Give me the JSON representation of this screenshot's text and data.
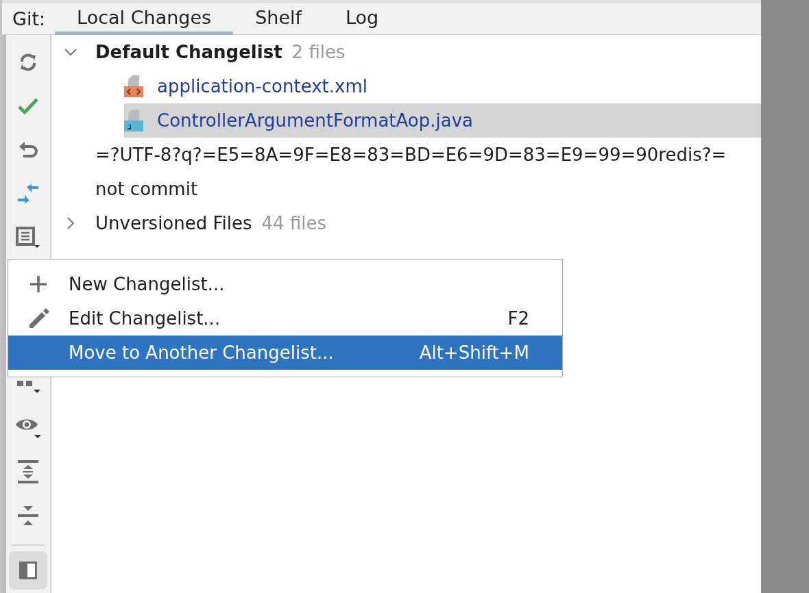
{
  "header": {
    "label": "Git:"
  },
  "tabs": [
    {
      "label": "Local Changes",
      "selected": true
    },
    {
      "label": "Shelf",
      "selected": false
    },
    {
      "label": "Log",
      "selected": false
    }
  ],
  "toolbar": [
    {
      "selected": false
    },
    {
      "selected": false
    },
    {
      "selected": false
    },
    {
      "selected": false
    },
    {
      "selected": false
    },
    {
      "selected": false
    },
    {
      "selected": false
    },
    {
      "selected": false
    },
    {
      "selected": false
    },
    {
      "selected": true
    }
  ],
  "tree": [
    {
      "kind": "changelist",
      "name": "Default Changelist",
      "count": "2 files",
      "expanded": true,
      "default": true,
      "children": [
        {
          "kind": "xml",
          "name": "application-context.xml",
          "selected": false
        },
        {
          "kind": "java",
          "name": "ControllerArgumentFormatAop.java",
          "selected": true
        }
      ]
    },
    {
      "kind": "text",
      "name": "=?UTF-8?q?=E5=8A=9F=E8=83=BD=E6=9D=83=E9=99=90redis?="
    },
    {
      "kind": "text",
      "name": "not commit"
    },
    {
      "kind": "changelist",
      "name": "Unversioned Files",
      "count": "44 files",
      "expanded": false,
      "default": false
    }
  ],
  "menu": [
    {
      "label": "New Changelist...",
      "selected": false
    },
    {
      "label": "Edit Changelist...",
      "shortcut": "F2",
      "selected": false
    },
    {
      "label": "Move to Another Changelist...",
      "shortcut": "Alt+Shift+M",
      "selected": true
    }
  ]
}
